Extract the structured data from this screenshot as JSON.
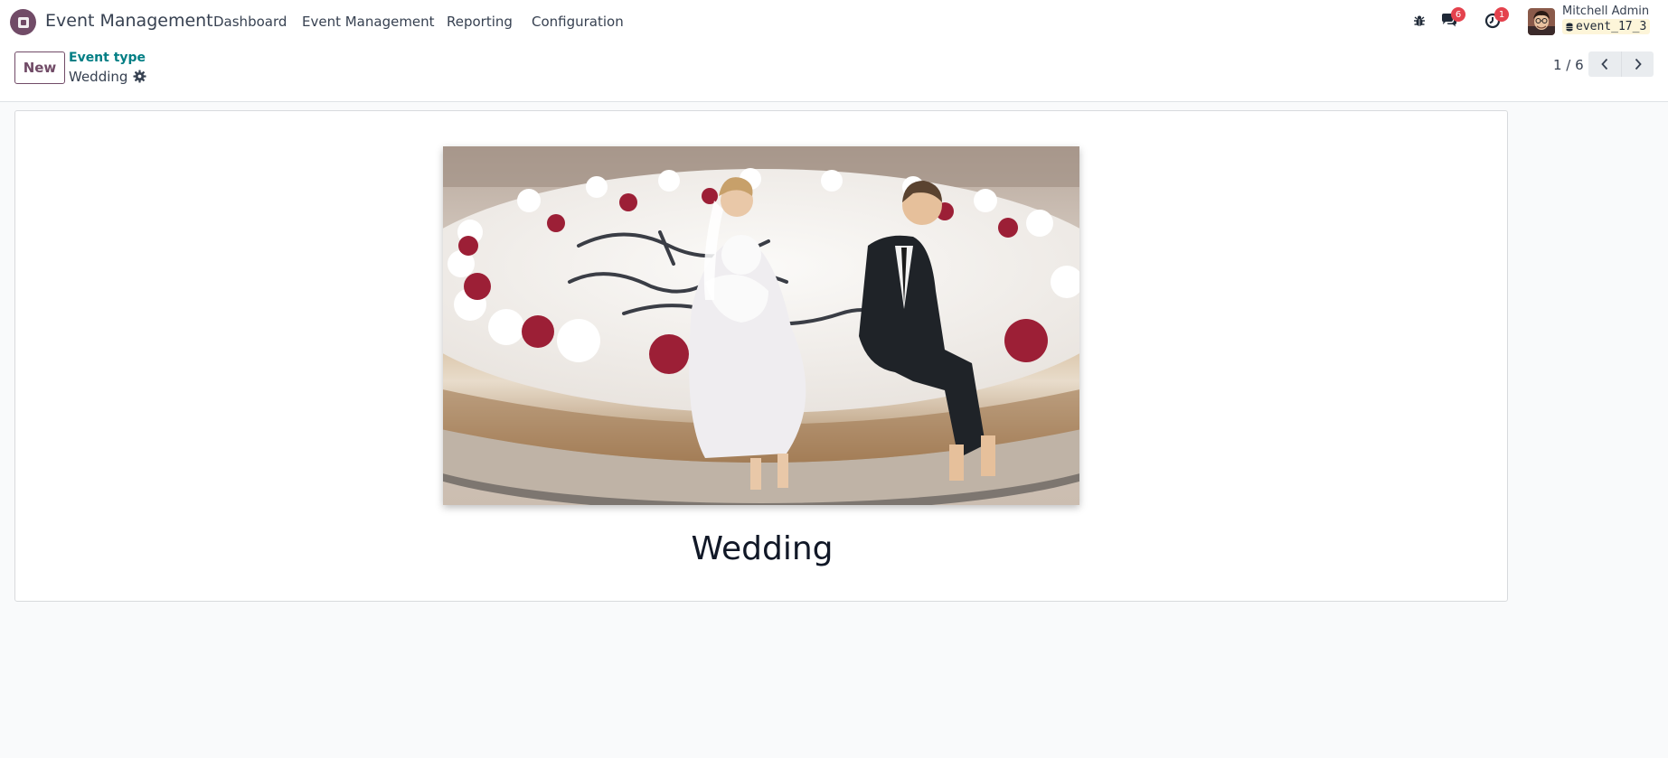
{
  "navbar": {
    "app_name": "Event Management",
    "menu": [
      "Dashboard",
      "Event Management",
      "Reporting",
      "Configuration"
    ],
    "messages_count": "6",
    "activities_count": "1",
    "user_name": "Mitchell Admin",
    "database": "event_17_3"
  },
  "control_panel": {
    "new_label": "New",
    "breadcrumb_parent": "Event type",
    "breadcrumb_current": "Wedding",
    "pager_value": "1 / 6"
  },
  "form": {
    "name": "Wedding",
    "image_subject": "wedding-cake-with-bride-and-groom-figurines"
  },
  "colors": {
    "brand": "#714b67",
    "link": "#017e84",
    "badge": "#e4424d"
  }
}
